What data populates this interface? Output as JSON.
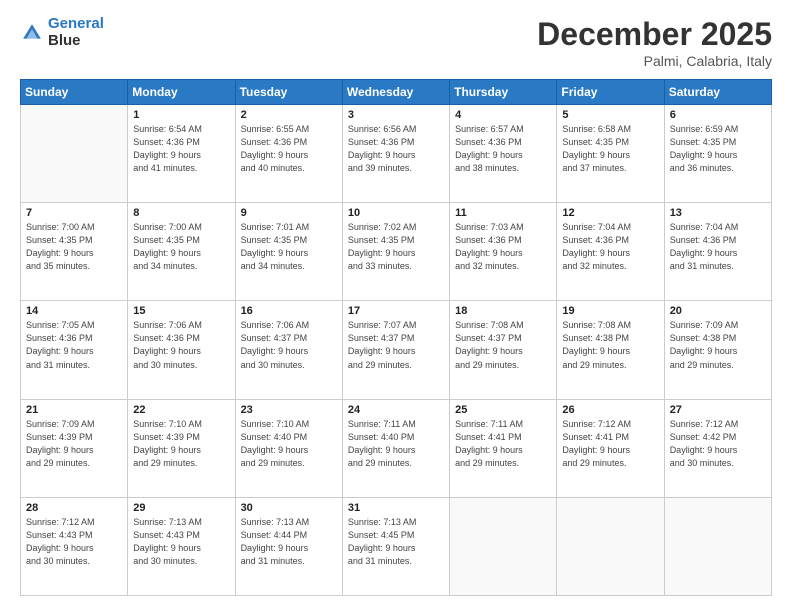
{
  "header": {
    "logo_line1": "General",
    "logo_line2": "Blue",
    "month": "December 2025",
    "location": "Palmi, Calabria, Italy"
  },
  "days_of_week": [
    "Sunday",
    "Monday",
    "Tuesday",
    "Wednesday",
    "Thursday",
    "Friday",
    "Saturday"
  ],
  "weeks": [
    [
      {
        "day": "",
        "lines": []
      },
      {
        "day": "1",
        "lines": [
          "Sunrise: 6:54 AM",
          "Sunset: 4:36 PM",
          "Daylight: 9 hours",
          "and 41 minutes."
        ]
      },
      {
        "day": "2",
        "lines": [
          "Sunrise: 6:55 AM",
          "Sunset: 4:36 PM",
          "Daylight: 9 hours",
          "and 40 minutes."
        ]
      },
      {
        "day": "3",
        "lines": [
          "Sunrise: 6:56 AM",
          "Sunset: 4:36 PM",
          "Daylight: 9 hours",
          "and 39 minutes."
        ]
      },
      {
        "day": "4",
        "lines": [
          "Sunrise: 6:57 AM",
          "Sunset: 4:36 PM",
          "Daylight: 9 hours",
          "and 38 minutes."
        ]
      },
      {
        "day": "5",
        "lines": [
          "Sunrise: 6:58 AM",
          "Sunset: 4:35 PM",
          "Daylight: 9 hours",
          "and 37 minutes."
        ]
      },
      {
        "day": "6",
        "lines": [
          "Sunrise: 6:59 AM",
          "Sunset: 4:35 PM",
          "Daylight: 9 hours",
          "and 36 minutes."
        ]
      }
    ],
    [
      {
        "day": "7",
        "lines": [
          "Sunrise: 7:00 AM",
          "Sunset: 4:35 PM",
          "Daylight: 9 hours",
          "and 35 minutes."
        ]
      },
      {
        "day": "8",
        "lines": [
          "Sunrise: 7:00 AM",
          "Sunset: 4:35 PM",
          "Daylight: 9 hours",
          "and 34 minutes."
        ]
      },
      {
        "day": "9",
        "lines": [
          "Sunrise: 7:01 AM",
          "Sunset: 4:35 PM",
          "Daylight: 9 hours",
          "and 34 minutes."
        ]
      },
      {
        "day": "10",
        "lines": [
          "Sunrise: 7:02 AM",
          "Sunset: 4:35 PM",
          "Daylight: 9 hours",
          "and 33 minutes."
        ]
      },
      {
        "day": "11",
        "lines": [
          "Sunrise: 7:03 AM",
          "Sunset: 4:36 PM",
          "Daylight: 9 hours",
          "and 32 minutes."
        ]
      },
      {
        "day": "12",
        "lines": [
          "Sunrise: 7:04 AM",
          "Sunset: 4:36 PM",
          "Daylight: 9 hours",
          "and 32 minutes."
        ]
      },
      {
        "day": "13",
        "lines": [
          "Sunrise: 7:04 AM",
          "Sunset: 4:36 PM",
          "Daylight: 9 hours",
          "and 31 minutes."
        ]
      }
    ],
    [
      {
        "day": "14",
        "lines": [
          "Sunrise: 7:05 AM",
          "Sunset: 4:36 PM",
          "Daylight: 9 hours",
          "and 31 minutes."
        ]
      },
      {
        "day": "15",
        "lines": [
          "Sunrise: 7:06 AM",
          "Sunset: 4:36 PM",
          "Daylight: 9 hours",
          "and 30 minutes."
        ]
      },
      {
        "day": "16",
        "lines": [
          "Sunrise: 7:06 AM",
          "Sunset: 4:37 PM",
          "Daylight: 9 hours",
          "and 30 minutes."
        ]
      },
      {
        "day": "17",
        "lines": [
          "Sunrise: 7:07 AM",
          "Sunset: 4:37 PM",
          "Daylight: 9 hours",
          "and 29 minutes."
        ]
      },
      {
        "day": "18",
        "lines": [
          "Sunrise: 7:08 AM",
          "Sunset: 4:37 PM",
          "Daylight: 9 hours",
          "and 29 minutes."
        ]
      },
      {
        "day": "19",
        "lines": [
          "Sunrise: 7:08 AM",
          "Sunset: 4:38 PM",
          "Daylight: 9 hours",
          "and 29 minutes."
        ]
      },
      {
        "day": "20",
        "lines": [
          "Sunrise: 7:09 AM",
          "Sunset: 4:38 PM",
          "Daylight: 9 hours",
          "and 29 minutes."
        ]
      }
    ],
    [
      {
        "day": "21",
        "lines": [
          "Sunrise: 7:09 AM",
          "Sunset: 4:39 PM",
          "Daylight: 9 hours",
          "and 29 minutes."
        ]
      },
      {
        "day": "22",
        "lines": [
          "Sunrise: 7:10 AM",
          "Sunset: 4:39 PM",
          "Daylight: 9 hours",
          "and 29 minutes."
        ]
      },
      {
        "day": "23",
        "lines": [
          "Sunrise: 7:10 AM",
          "Sunset: 4:40 PM",
          "Daylight: 9 hours",
          "and 29 minutes."
        ]
      },
      {
        "day": "24",
        "lines": [
          "Sunrise: 7:11 AM",
          "Sunset: 4:40 PM",
          "Daylight: 9 hours",
          "and 29 minutes."
        ]
      },
      {
        "day": "25",
        "lines": [
          "Sunrise: 7:11 AM",
          "Sunset: 4:41 PM",
          "Daylight: 9 hours",
          "and 29 minutes."
        ]
      },
      {
        "day": "26",
        "lines": [
          "Sunrise: 7:12 AM",
          "Sunset: 4:41 PM",
          "Daylight: 9 hours",
          "and 29 minutes."
        ]
      },
      {
        "day": "27",
        "lines": [
          "Sunrise: 7:12 AM",
          "Sunset: 4:42 PM",
          "Daylight: 9 hours",
          "and 30 minutes."
        ]
      }
    ],
    [
      {
        "day": "28",
        "lines": [
          "Sunrise: 7:12 AM",
          "Sunset: 4:43 PM",
          "Daylight: 9 hours",
          "and 30 minutes."
        ]
      },
      {
        "day": "29",
        "lines": [
          "Sunrise: 7:13 AM",
          "Sunset: 4:43 PM",
          "Daylight: 9 hours",
          "and 30 minutes."
        ]
      },
      {
        "day": "30",
        "lines": [
          "Sunrise: 7:13 AM",
          "Sunset: 4:44 PM",
          "Daylight: 9 hours",
          "and 31 minutes."
        ]
      },
      {
        "day": "31",
        "lines": [
          "Sunrise: 7:13 AM",
          "Sunset: 4:45 PM",
          "Daylight: 9 hours",
          "and 31 minutes."
        ]
      },
      {
        "day": "",
        "lines": []
      },
      {
        "day": "",
        "lines": []
      },
      {
        "day": "",
        "lines": []
      }
    ]
  ]
}
